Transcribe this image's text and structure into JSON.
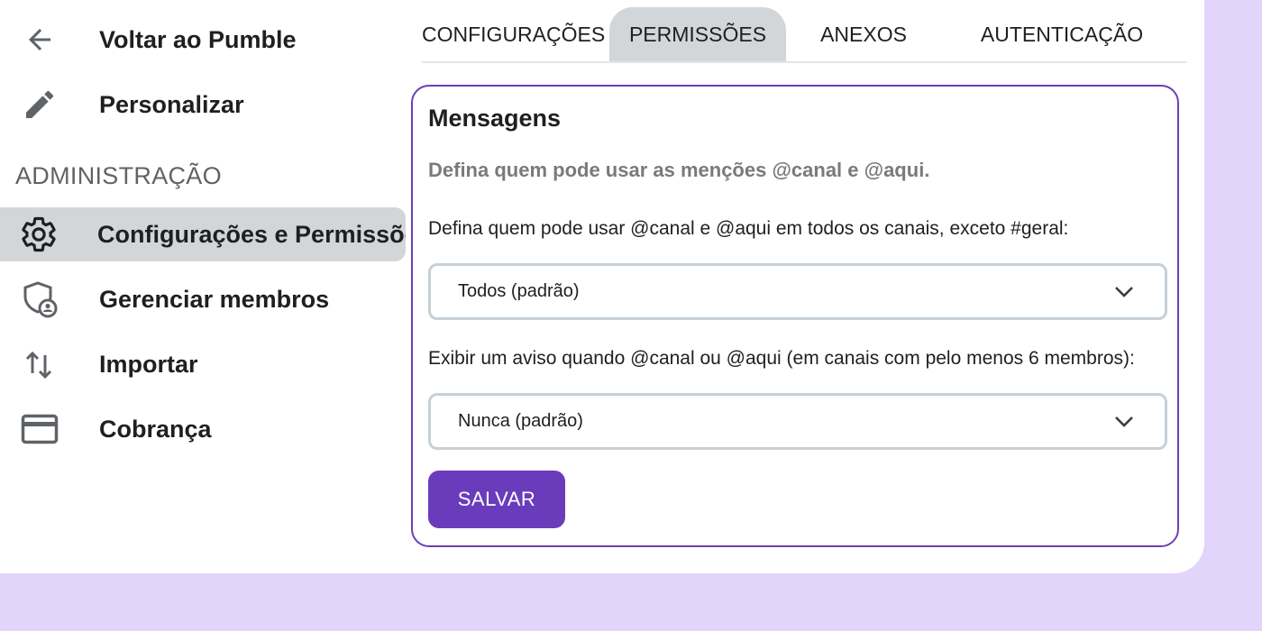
{
  "sidebar": {
    "back_label": "Voltar ao Pumble",
    "customize_label": "Personalizar",
    "section_label": "ADMINISTRAÇÃO",
    "items": [
      {
        "label": "Configurações e Permissões",
        "icon": "gear-icon",
        "active": true
      },
      {
        "label": "Gerenciar membros",
        "icon": "shield-user-icon"
      },
      {
        "label": "Importar",
        "icon": "import-arrows-icon"
      },
      {
        "label": "Cobrança",
        "icon": "credit-card-icon"
      }
    ]
  },
  "tabs": [
    {
      "label": "CONFIGURAÇÕES"
    },
    {
      "label": "PERMISSÕES",
      "active": true
    },
    {
      "label": "ANEXOS"
    },
    {
      "label": "AUTENTICAÇÃO"
    }
  ],
  "card": {
    "title": "Mensagens",
    "subtitle": "Defina quem pode usar as menções @canal e @aqui.",
    "field1_label": "Defina quem pode usar @canal e @aqui em todos os canais, exceto #geral:",
    "field1_value": "Todos (padrão)",
    "field2_label": "Exibir um aviso quando @canal ou @aqui (em canais com pelo menos 6 membros):",
    "field2_value": "Nunca (padrão)",
    "save_label": "SALVAR"
  },
  "colors": {
    "accent": "#6a3cbc",
    "background": "#e3d4fc",
    "active_bg": "#d3d6d9"
  }
}
